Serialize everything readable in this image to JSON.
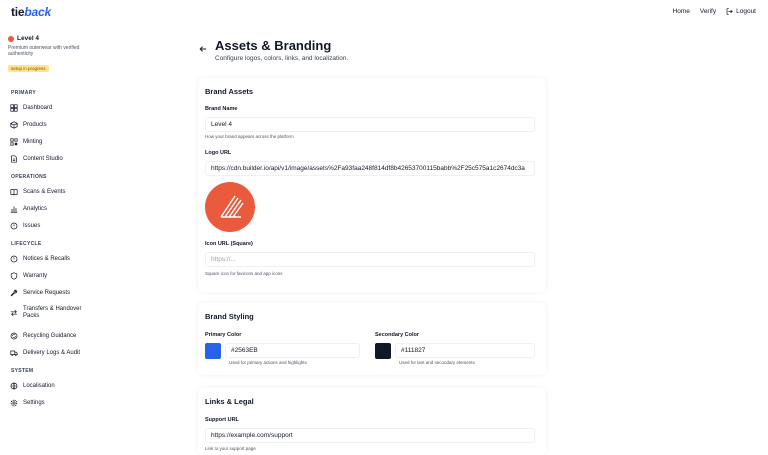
{
  "app": {
    "logo_part1": "tie",
    "logo_part2": "back"
  },
  "topnav": {
    "home": "Home",
    "verify": "Verify",
    "logout": "Logout"
  },
  "sidebar": {
    "brand_name": "Level 4",
    "brand_desc": "Premium outerwear with verified authenticity",
    "badge": "setup in progress",
    "sections": {
      "primary": "PRIMARY",
      "operations": "OPERATIONS",
      "lifecycle": "LIFECYCLE",
      "system": "SYSTEM"
    },
    "items": {
      "dashboard": "Dashboard",
      "products": "Products",
      "minting": "Minting",
      "content_studio": "Content Studio",
      "scans_events": "Scans & Events",
      "analytics": "Analytics",
      "issues": "Issues",
      "notices_recalls": "Notices & Recalls",
      "warranty": "Warranty",
      "service_requests": "Service Requests",
      "transfers": "Transfers & Handover Packs",
      "recycling": "Recycling Guidance",
      "delivery_logs": "Delivery Logs & Audit",
      "localisation": "Localisation",
      "settings": "Settings"
    }
  },
  "page": {
    "title": "Assets & Branding",
    "subtitle": "Configure logos, colors, links, and localization."
  },
  "brand_assets": {
    "title": "Brand Assets",
    "brand_name_label": "Brand Name",
    "brand_name_value": "Level 4",
    "brand_name_hint": "How your brand appears across the platform",
    "logo_url_label": "Logo URL",
    "logo_url_value": "https://cdn.builder.io/api/v1/image/assets%2Fa93faa248f814df8b42653700115babb%2F25c575a1c2674dc3a",
    "icon_url_label": "Icon URL (Square)",
    "icon_url_placeholder": "https://...",
    "icon_url_hint": "Square icon for favicons and app icons"
  },
  "brand_styling": {
    "title": "Brand Styling",
    "primary_label": "Primary Color",
    "primary_value": "#2563EB",
    "primary_hint": "Used for primary actions and highlights",
    "secondary_label": "Secondary Color",
    "secondary_value": "#111827",
    "secondary_hint": "Used for text and secondary elements"
  },
  "links_legal": {
    "title": "Links & Legal",
    "support_label": "Support URL",
    "support_value": "https://example.com/support",
    "support_hint": "Link to your support page"
  },
  "colors": {
    "accent": "#2563eb",
    "dark": "#111827",
    "logo_orange": "#ea5b3d"
  },
  "icons": {
    "back": "arrow-left-icon",
    "logout": "logout-icon"
  }
}
